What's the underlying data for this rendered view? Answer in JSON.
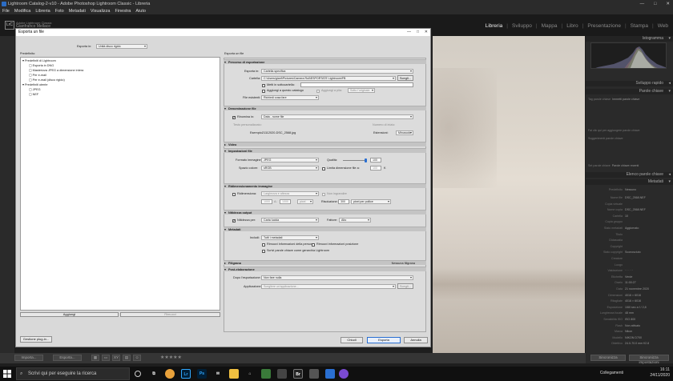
{
  "window": {
    "title": "Lightroom Catalog-2-v10 - Adobe Photoshop Lightroom Classic - Libreria",
    "controls": [
      "—",
      "□",
      "✕"
    ]
  },
  "menu": [
    "File",
    "Modifica",
    "Libreria",
    "Foto",
    "Metadati",
    "Visualizza",
    "Finestra",
    "Aiuto"
  ],
  "identity": {
    "logo": "LrC",
    "line1": "Adobe Lightroom Classic",
    "line2": "Gianfranco Mellace"
  },
  "modules": [
    "Libreria",
    "Sviluppo",
    "Mappa",
    "Libro",
    "Presentazione",
    "Stampa",
    "Web"
  ],
  "active_module": "Libreria",
  "right_panel": {
    "headers": {
      "histogram": "Istogramma",
      "quick_develop": "Sviluppo rapido",
      "keywording": "Parole chiave",
      "keyword_list": "Elenco parole chiave",
      "metadata": "Metadati"
    },
    "keyword_tag_label": "Tag parole chiave",
    "keyword_tag_value": "Immetti parole chiave",
    "keyword_hint": "Fai clic qui per aggiungere parole chiave",
    "keyword_suggestions": "Suggerimenti parole chiave",
    "keyword_set_label": "Set parole chiave",
    "keyword_set_value": "Parole chiave recenti",
    "metadata_preset_label": "Predefinito",
    "metadata_preset_value": "Nessuno",
    "metadata_rows": [
      {
        "k": "Nome file",
        "v": "DSC_2568.NEF"
      },
      {
        "k": "Copia virtuale",
        "v": ""
      },
      {
        "k": "Nome copia",
        "v": "DSC_2568.NEF"
      },
      {
        "k": "Cartella",
        "v": "10"
      },
      {
        "k": "Copia gruppo",
        "v": ""
      },
      {
        "k": "Stato metadati",
        "v": "Aggiornato"
      },
      {
        "k": "Titolo",
        "v": ""
      },
      {
        "k": "Didascalia",
        "v": ""
      },
      {
        "k": "Copyright",
        "v": ""
      },
      {
        "k": "Stato copyright",
        "v": "Sconosciuto"
      },
      {
        "k": "Creatore",
        "v": ""
      },
      {
        "k": "Luogo",
        "v": ""
      },
      {
        "k": "Valutazione",
        "v": "· · · · ·"
      },
      {
        "k": "Etichetta",
        "v": "Verde"
      },
      {
        "k": "Orario",
        "v": "11:00:27"
      },
      {
        "k": "Data",
        "v": "21 novembre 2020"
      },
      {
        "k": "Dimensioni",
        "v": "4016 × 6016"
      },
      {
        "k": "Ritagliate",
        "v": "4016 × 6016"
      },
      {
        "k": "Esposizione",
        "v": "1/60 sec a f / 2,8"
      },
      {
        "k": "Lunghezza focale",
        "v": "48 mm"
      },
      {
        "k": "Sensibilità ISO",
        "v": "ISO 800"
      },
      {
        "k": "Flash",
        "v": "Non attivato"
      },
      {
        "k": "Marca",
        "v": "Nikon"
      },
      {
        "k": "Modello",
        "v": "NIKON D700"
      },
      {
        "k": "Obiettivo",
        "v": "24.0-70.0 mm f/2.8"
      }
    ],
    "bottom_buttons": [
      "Sincronizza",
      "Sincronizza impostazioni"
    ]
  },
  "toolbar": {
    "import": "Importa...",
    "export": "Esporta..."
  },
  "taskbar": {
    "search_placeholder": "Scrivi qui per eseguire la ricerca",
    "tray_label": "Collegamenti",
    "time": "16:11",
    "date": "24/11/2020"
  },
  "dialog": {
    "title": "Esporta un file",
    "export_to_label": "Esporta in:",
    "export_to_value": "Unità disco rigido",
    "preset_title": "Predefinito:",
    "file_title": "Esporta un file",
    "preset_tree": [
      {
        "label": "Predefiniti di Lightroom",
        "level": 0,
        "expanded": true
      },
      {
        "label": "Esporta in DNG",
        "level": 1
      },
      {
        "label": "Masterizza JPEG a dimensione intera",
        "level": 1
      },
      {
        "label": "Per e-mail",
        "level": 1
      },
      {
        "label": "Per e-mail (disco rigido)",
        "level": 1
      },
      {
        "label": "Predefiniti utente",
        "level": 0,
        "expanded": true
      },
      {
        "label": "JPEG",
        "level": 1
      },
      {
        "label": "NEF",
        "level": 1
      }
    ],
    "add_button": "Aggiungi",
    "remove_button": "Rimuovi",
    "plugin_button": "Gestione plug-in...",
    "done_button": "Chiudi",
    "export_button": "Esporta",
    "cancel_button": "Annulla",
    "sections": {
      "location": {
        "title": "Percorso di esportazione",
        "export_in_label": "Esporta in:",
        "export_in_value": "Cartella specifica",
        "folder_label": "Cartella:",
        "folder_value": "C:\\Users\\gianf\\Pictures\\Camera Roll\\ESPORTATE Lightroom\\FB",
        "choose_button": "Scegli...",
        "subfolder_label": "Metti in sottocartella:",
        "add_catalog_label": "Aggiungi a questo catalogo",
        "add_stack_label": "Aggiungi a pila:",
        "stack_value": "Sotto l'originale",
        "existing_label": "File esistenti:",
        "existing_value": "Richiedi cosa fare"
      },
      "naming": {
        "title": "Denominazione file",
        "rename_label": "Rinomina in:",
        "rename_value": "Data - nome file",
        "custom_text_label": "Testo personalizzato:",
        "start_number_label": "Numero di inizio:",
        "example_label": "Esempio:",
        "example_value": "21112020-DSC_2568.jpg",
        "extensions_label": "Estensioni:",
        "extensions_value": "Minuscole"
      },
      "video": {
        "title": "Video"
      },
      "file_settings": {
        "title": "Impostazioni file",
        "format_label": "Formato immagine:",
        "format_value": "JPEG",
        "quality_label": "Qualità:",
        "quality_value": "100",
        "quality_fraction": 1.0,
        "colorspace_label": "Spazio colore:",
        "colorspace_value": "sRGB",
        "limit_label": "Limita dimensione file a:",
        "limit_value": "100",
        "limit_unit": "K"
      },
      "sizing": {
        "title": "Ridimensionamento immagine",
        "resize_label": "Ridimensiona:",
        "resize_value": "Larghezza e altezza",
        "no_enlarge_label": "Non ingrandire",
        "w_value": "1000",
        "x_sep": "A:",
        "h_value": "1000",
        "unit_value": "pixel",
        "resolution_label": "Risoluzione:",
        "resolution_value": "300",
        "resolution_unit": "pixel per pollice"
      },
      "sharpening": {
        "title": "Nitidezza output",
        "sharpen_label": "Nitidezza per:",
        "sharpen_value": "Carta lucida",
        "amount_label": "Fattore:",
        "amount_value": "Alto"
      },
      "metadata": {
        "title": "Metadati",
        "include_label": "Includi:",
        "include_value": "Tutti i metadati",
        "remove_person_label": "Rimuovi informazioni della persona",
        "remove_location_label": "Rimuovi informazioni posizione",
        "hierarchy_label": "Scrivi parole chiave come gerarchia Lightroom"
      },
      "watermark": {
        "title": "Filigrana",
        "summary": "Nessuna filigrana"
      },
      "post": {
        "title": "Post-elaborazione",
        "after_label": "Dopo l'esportazione:",
        "after_value": "Non fare nulla",
        "app_label": "Applicazione:",
        "app_placeholder": "Scegliere un'applicazione...",
        "choose_button": "Scegli..."
      }
    }
  }
}
